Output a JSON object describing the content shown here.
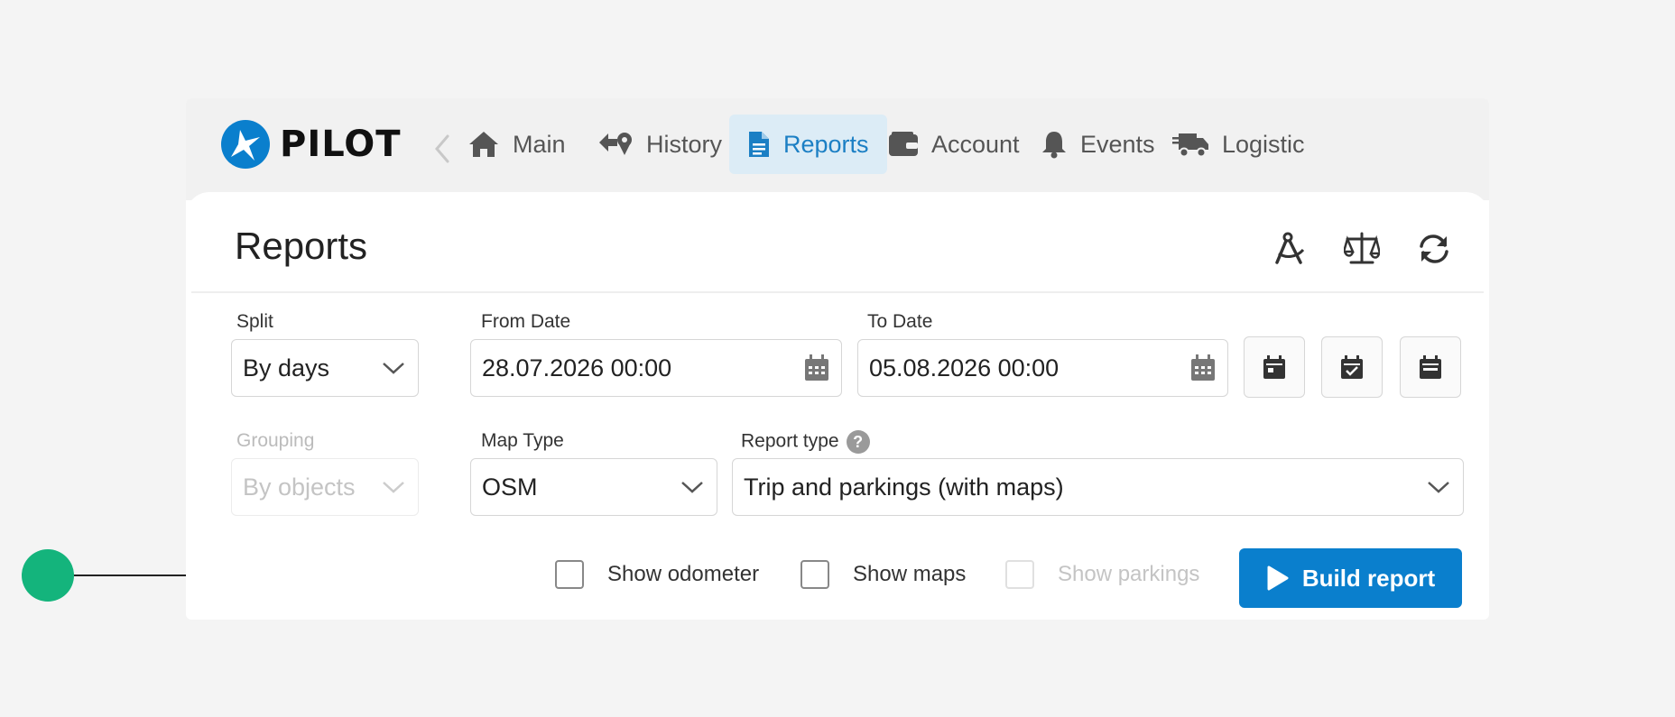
{
  "brand": {
    "name": "PILOT"
  },
  "nav": {
    "items": [
      {
        "label": "Main",
        "icon": "home-icon"
      },
      {
        "label": "History",
        "icon": "history-icon"
      },
      {
        "label": "Reports",
        "icon": "document-icon",
        "active": true
      },
      {
        "label": "Account",
        "icon": "wallet-icon"
      },
      {
        "label": "Events",
        "icon": "bell-icon"
      },
      {
        "label": "Logistic",
        "icon": "truck-icon"
      }
    ]
  },
  "page": {
    "title": "Reports"
  },
  "header_icons": [
    "compass-icon",
    "scales-icon",
    "refresh-icon"
  ],
  "form": {
    "split": {
      "label": "Split",
      "value": "By days"
    },
    "from_date": {
      "label": "From Date",
      "value": "28.07.2026 00:00"
    },
    "to_date": {
      "label": "To Date",
      "value": "05.08.2026 00:00"
    },
    "quick_buttons": [
      "calendar-day-icon",
      "calendar-check-icon",
      "calendar-month-icon"
    ],
    "grouping": {
      "label": "Grouping",
      "value": "By objects",
      "disabled": true
    },
    "map_type": {
      "label": "Map Type",
      "value": "OSM"
    },
    "report_type": {
      "label": "Report type",
      "value": "Trip and parkings (with maps)",
      "help": "?"
    },
    "checkboxes": {
      "show_odometer": {
        "label": "Show odometer",
        "checked": false
      },
      "show_maps": {
        "label": "Show maps",
        "checked": false
      },
      "show_parkings": {
        "label": "Show parkings",
        "checked": false,
        "disabled": true
      }
    },
    "build_button": {
      "label": "Build report"
    }
  },
  "colors": {
    "accent": "#0a7fcd",
    "active_nav_bg": "#dcecf6",
    "active_nav_text": "#1b7fc4",
    "pointer_dot": "#14b47c",
    "background": "#f4f4f4"
  }
}
